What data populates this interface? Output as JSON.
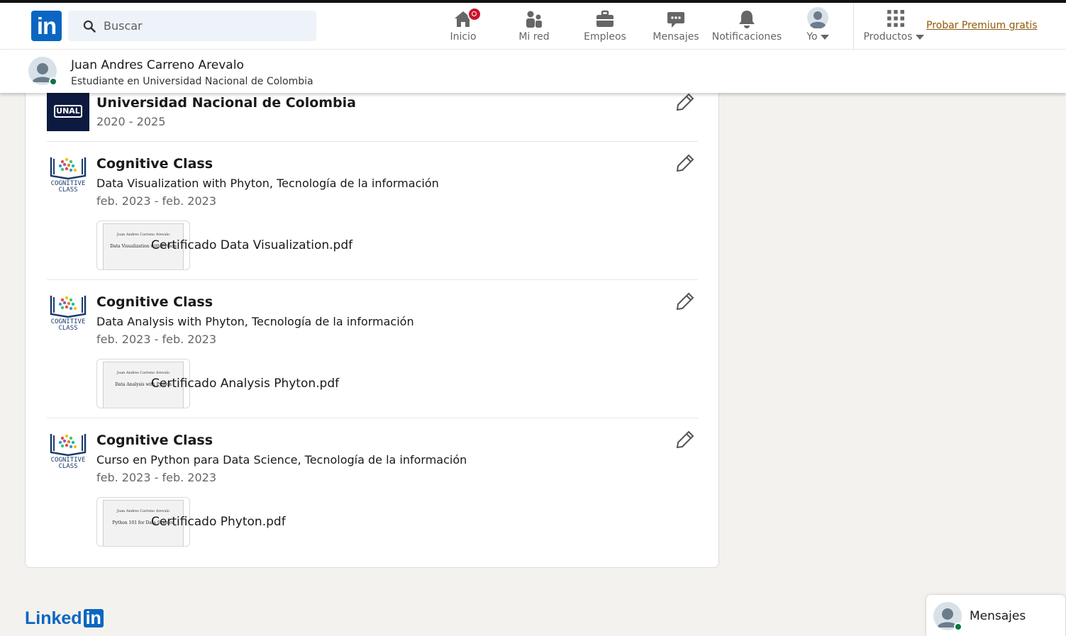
{
  "nav": {
    "logo_text": "in",
    "search_placeholder": "Buscar",
    "items": [
      {
        "label": "Inicio",
        "icon": "home-icon",
        "badge": true
      },
      {
        "label": "Mi red",
        "icon": "network-icon"
      },
      {
        "label": "Empleos",
        "icon": "briefcase-icon"
      },
      {
        "label": "Mensajes",
        "icon": "chat-icon"
      },
      {
        "label": "Notificaciones",
        "icon": "bell-icon"
      },
      {
        "label": "Yo",
        "icon": "avatar"
      },
      {
        "label": "Productos",
        "icon": "grid-icon"
      }
    ],
    "premium": "Probar Premium gratis"
  },
  "profile": {
    "name": "Juan Andres Carreno Arevalo",
    "headline": "Estudiante en Universidad Nacional de Colombia"
  },
  "education": [
    {
      "institution": "Universidad Nacional de Colombia",
      "dates": "2020 - 2025",
      "logo_text": "UNAL",
      "logo_color": "#0d1a3f"
    },
    {
      "institution": "Cognitive Class",
      "degree": "Data Visualization with Phyton, Tecnología de la información",
      "dates": "feb. 2023 - feb. 2023",
      "media": "Certificado Data Visualization.pdf",
      "thumb_title": "Data Visualization with Python"
    },
    {
      "institution": "Cognitive Class",
      "degree": "Data Analysis with Phyton, Tecnología de la información",
      "dates": "feb. 2023 - feb. 2023",
      "media": "Certificado Analysis Phyton.pdf",
      "thumb_title": "Data Analysis with Python"
    },
    {
      "institution": "Cognitive Class",
      "degree": "Curso en Python para Data Science, Tecnología de la información",
      "dates": "feb. 2023 - feb. 2023",
      "media": "Certificado Phyton.pdf",
      "thumb_title": "Python 101 for Data Science"
    }
  ],
  "cognitive_logo": {
    "line1": "COGNITIVE",
    "line2": "CLASS"
  },
  "certificate_name": "Juan Andres Carreno Arevalo",
  "footer": {
    "brand": "Linked",
    "brand_in": "in"
  },
  "messaging": {
    "label": "Mensajes"
  },
  "colors": {
    "brand": "#0a66c2",
    "premium": "#915907",
    "online": "#057642",
    "notification": "#cb112d"
  }
}
